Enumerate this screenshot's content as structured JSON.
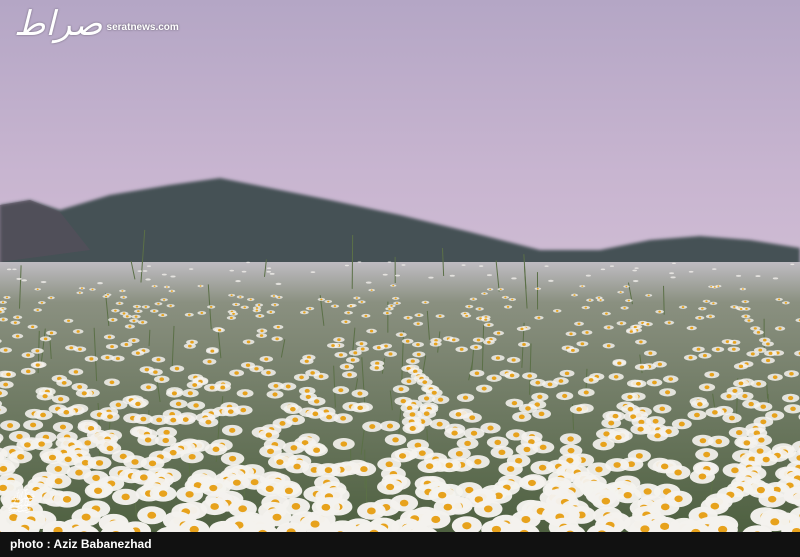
{
  "watermark": {
    "site": "seratnews.com",
    "logo_glyph": "صراط"
  },
  "credit": "photo : Aziz Babanezhad",
  "colors": {
    "sky_top": "#b7a7c4",
    "sky_bottom": "#c9b7d2",
    "mountain": "#3f4d4f",
    "flower": "#f4f2ee",
    "center": "#e7a21c"
  }
}
